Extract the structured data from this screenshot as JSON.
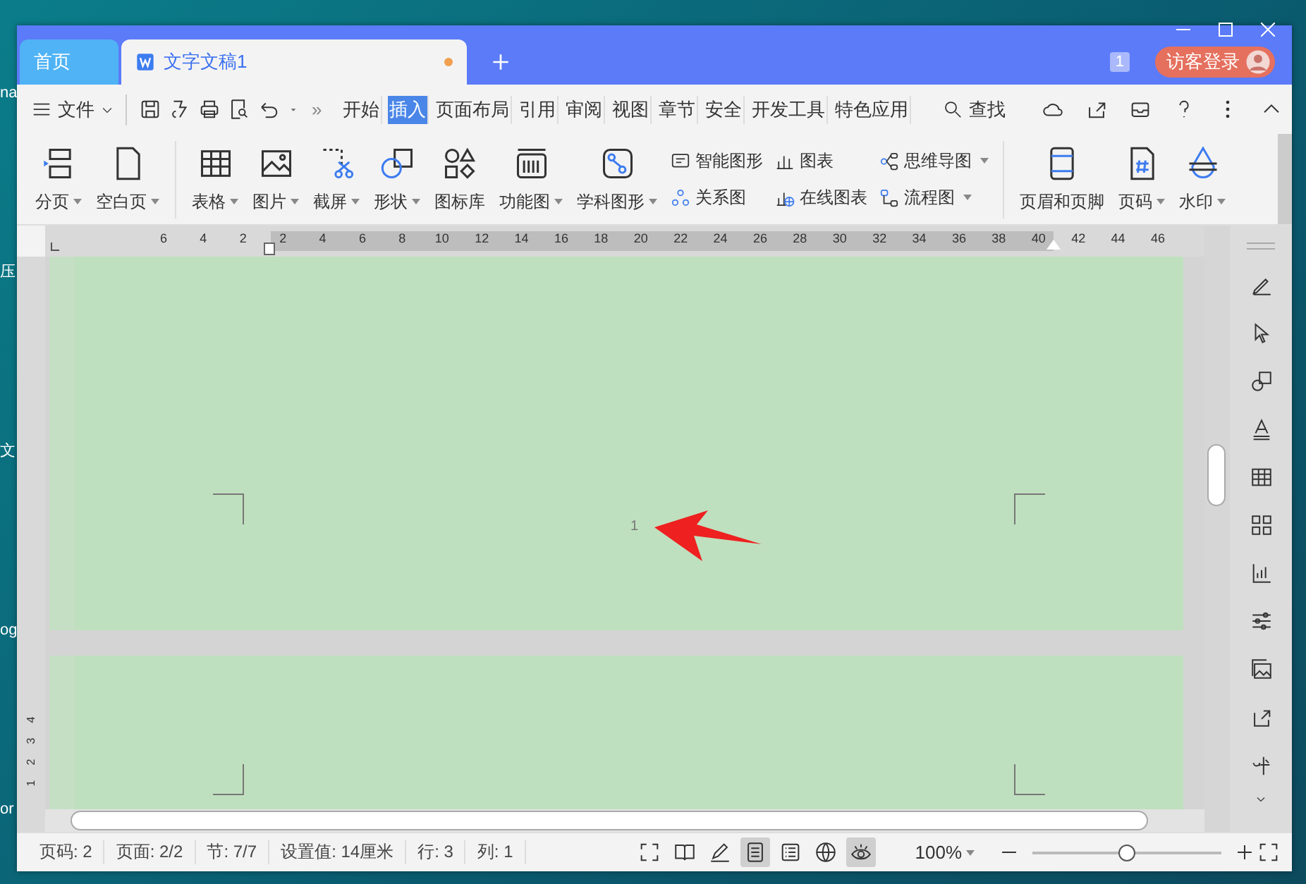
{
  "desktop": {
    "labels": [
      "na",
      "压",
      "文",
      "og",
      "or"
    ]
  },
  "tabs": [
    {
      "label": "首页",
      "selected": false,
      "unsaved": false
    },
    {
      "label": "文字文稿1",
      "selected": true,
      "unsaved": true
    }
  ],
  "title_bar": {
    "badge": "1",
    "account": "访客登录"
  },
  "menu_bar": {
    "file": "文件",
    "more": "»",
    "tabs": [
      {
        "label": "开始",
        "selected": false
      },
      {
        "label": "插入",
        "selected": true
      },
      {
        "label": "页面布局",
        "selected": false
      },
      {
        "label": "引用",
        "selected": false
      },
      {
        "label": "审阅",
        "selected": false
      },
      {
        "label": "视图",
        "selected": false
      },
      {
        "label": "章节",
        "selected": false
      },
      {
        "label": "安全",
        "selected": false
      },
      {
        "label": "开发工具",
        "selected": false
      },
      {
        "label": "特色应用",
        "selected": false
      }
    ],
    "search": "查找"
  },
  "ribbon": {
    "items": [
      {
        "kind": "large",
        "label": "分页",
        "dropdown": true
      },
      {
        "kind": "large",
        "label": "空白页",
        "dropdown": true
      },
      {
        "kind": "separator"
      },
      {
        "kind": "large",
        "label": "表格",
        "dropdown": true
      },
      {
        "kind": "large",
        "label": "图片",
        "dropdown": true
      },
      {
        "kind": "large",
        "label": "截屏",
        "dropdown": true
      },
      {
        "kind": "large",
        "label": "形状",
        "dropdown": true
      },
      {
        "kind": "large",
        "label": "图标库",
        "dropdown": false
      },
      {
        "kind": "large",
        "label": "功能图",
        "dropdown": true
      },
      {
        "kind": "large",
        "label": "学科图形",
        "dropdown": true
      },
      {
        "kind": "stack",
        "children": [
          {
            "label": "智能图形",
            "dropdown": false
          },
          {
            "label": "关系图",
            "dropdown": false
          }
        ]
      },
      {
        "kind": "stack",
        "children": [
          {
            "label": "图表",
            "dropdown": false
          },
          {
            "label": "在线图表",
            "dropdown": false
          }
        ]
      },
      {
        "kind": "stack",
        "children": [
          {
            "label": "思维导图",
            "dropdown": true
          },
          {
            "label": "流程图",
            "dropdown": true
          }
        ]
      },
      {
        "kind": "separator"
      },
      {
        "kind": "large",
        "label": "页眉和页脚",
        "dropdown": false
      },
      {
        "kind": "large",
        "label": "页码",
        "dropdown": true
      },
      {
        "kind": "large",
        "label": "水印",
        "dropdown": true
      }
    ]
  },
  "ruler": {
    "labels": [
      "6",
      "4",
      "2",
      "2",
      "4",
      "6",
      "8",
      "10",
      "12",
      "14",
      "16",
      "18",
      "20",
      "22",
      "24",
      "26",
      "28",
      "30",
      "32",
      "34",
      "36",
      "38",
      "40",
      "42",
      "44",
      "46"
    ]
  },
  "vertical_ruler": {
    "labels": [
      "4",
      "3",
      "2",
      "1"
    ]
  },
  "document": {
    "page_number": "1"
  },
  "status_bar": {
    "items": [
      "页码: 2",
      "页面: 2/2",
      "节: 7/7",
      "设置值: 14厘米",
      "行: 3",
      "列: 1"
    ],
    "views": [
      {
        "selected": false
      },
      {
        "selected": false
      },
      {
        "selected": false
      },
      {
        "selected": true
      },
      {
        "selected": false
      },
      {
        "selected": false
      },
      {
        "selected": true
      }
    ],
    "zoom": "100%",
    "zoom_slider": {
      "level": 0.5
    }
  }
}
